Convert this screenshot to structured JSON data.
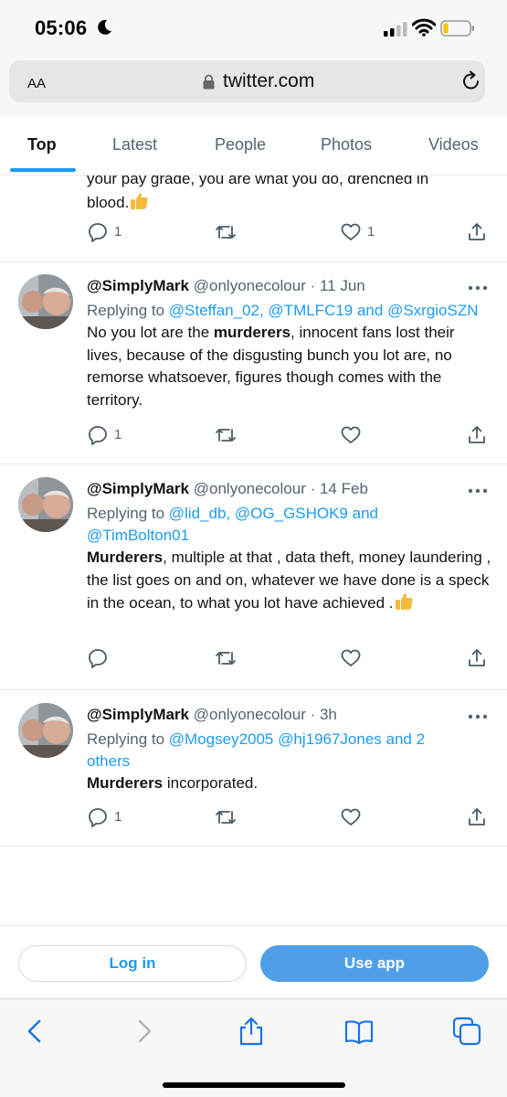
{
  "status_bar": {
    "time": "05:06"
  },
  "browser": {
    "text_size_label": "AA",
    "url": "twitter.com"
  },
  "tabs": [
    {
      "label": "Top",
      "active": true
    },
    {
      "label": "Latest",
      "active": false
    },
    {
      "label": "People",
      "active": false
    },
    {
      "label": "Photos",
      "active": false
    },
    {
      "label": "Videos",
      "active": false
    }
  ],
  "tweets": [
    {
      "body_partial": "your pay grade, you are what you do, drenched in",
      "body_line2": "blood.",
      "actions": {
        "replies": "1",
        "likes": "1"
      }
    },
    {
      "display": "@SimplyMark",
      "handle": "@onlyonecolour",
      "sep": " · ",
      "date": "11 Jun",
      "replying_prefix": "Replying to ",
      "replying_to": [
        "@Steffan_02",
        "@TMLFC19",
        "@SxrgioSZN"
      ],
      "replying_sep": [
        ", ",
        " and "
      ],
      "highlight": "murderers",
      "body_before": "No you lot are the ",
      "body_after": ", innocent fans lost their lives, because of the disgusting bunch you lot are, no remorse whatsoever, figures though comes with the territory.",
      "actions": {
        "replies": "1"
      }
    },
    {
      "display": "@SimplyMark",
      "handle": "@onlyonecolour",
      "sep": " · ",
      "date": "14 Feb",
      "replying_prefix": "Replying to ",
      "replying_to": [
        "@lid_db",
        "@OG_GSHOK9",
        "@TimBolton01"
      ],
      "replying_sep": [
        ", ",
        " and "
      ],
      "highlight": "Murderers",
      "body_after": ", multiple at that , data theft, money laundering , the list goes on and on, whatever we have done is a speck in the ocean,  to what you lot have achieved ."
    },
    {
      "display": "@SimplyMark",
      "handle": "@onlyonecolour",
      "sep": " · ",
      "date": "3h",
      "replying_prefix": "Replying to ",
      "replying_to": [
        "@Mogsey2005",
        "@hj1967Jones"
      ],
      "replying_sep": [
        " ",
        "  and 2 others"
      ],
      "highlight": "Murderers",
      "body_after": " incorporated.",
      "actions": {
        "replies": "1"
      }
    }
  ],
  "cta": {
    "login_label": "Log in",
    "app_label": "Use app"
  },
  "colors": {
    "accent": "#1d9bf0",
    "use_app_bg": "#4f9ee8",
    "secondary_text": "#536471"
  }
}
